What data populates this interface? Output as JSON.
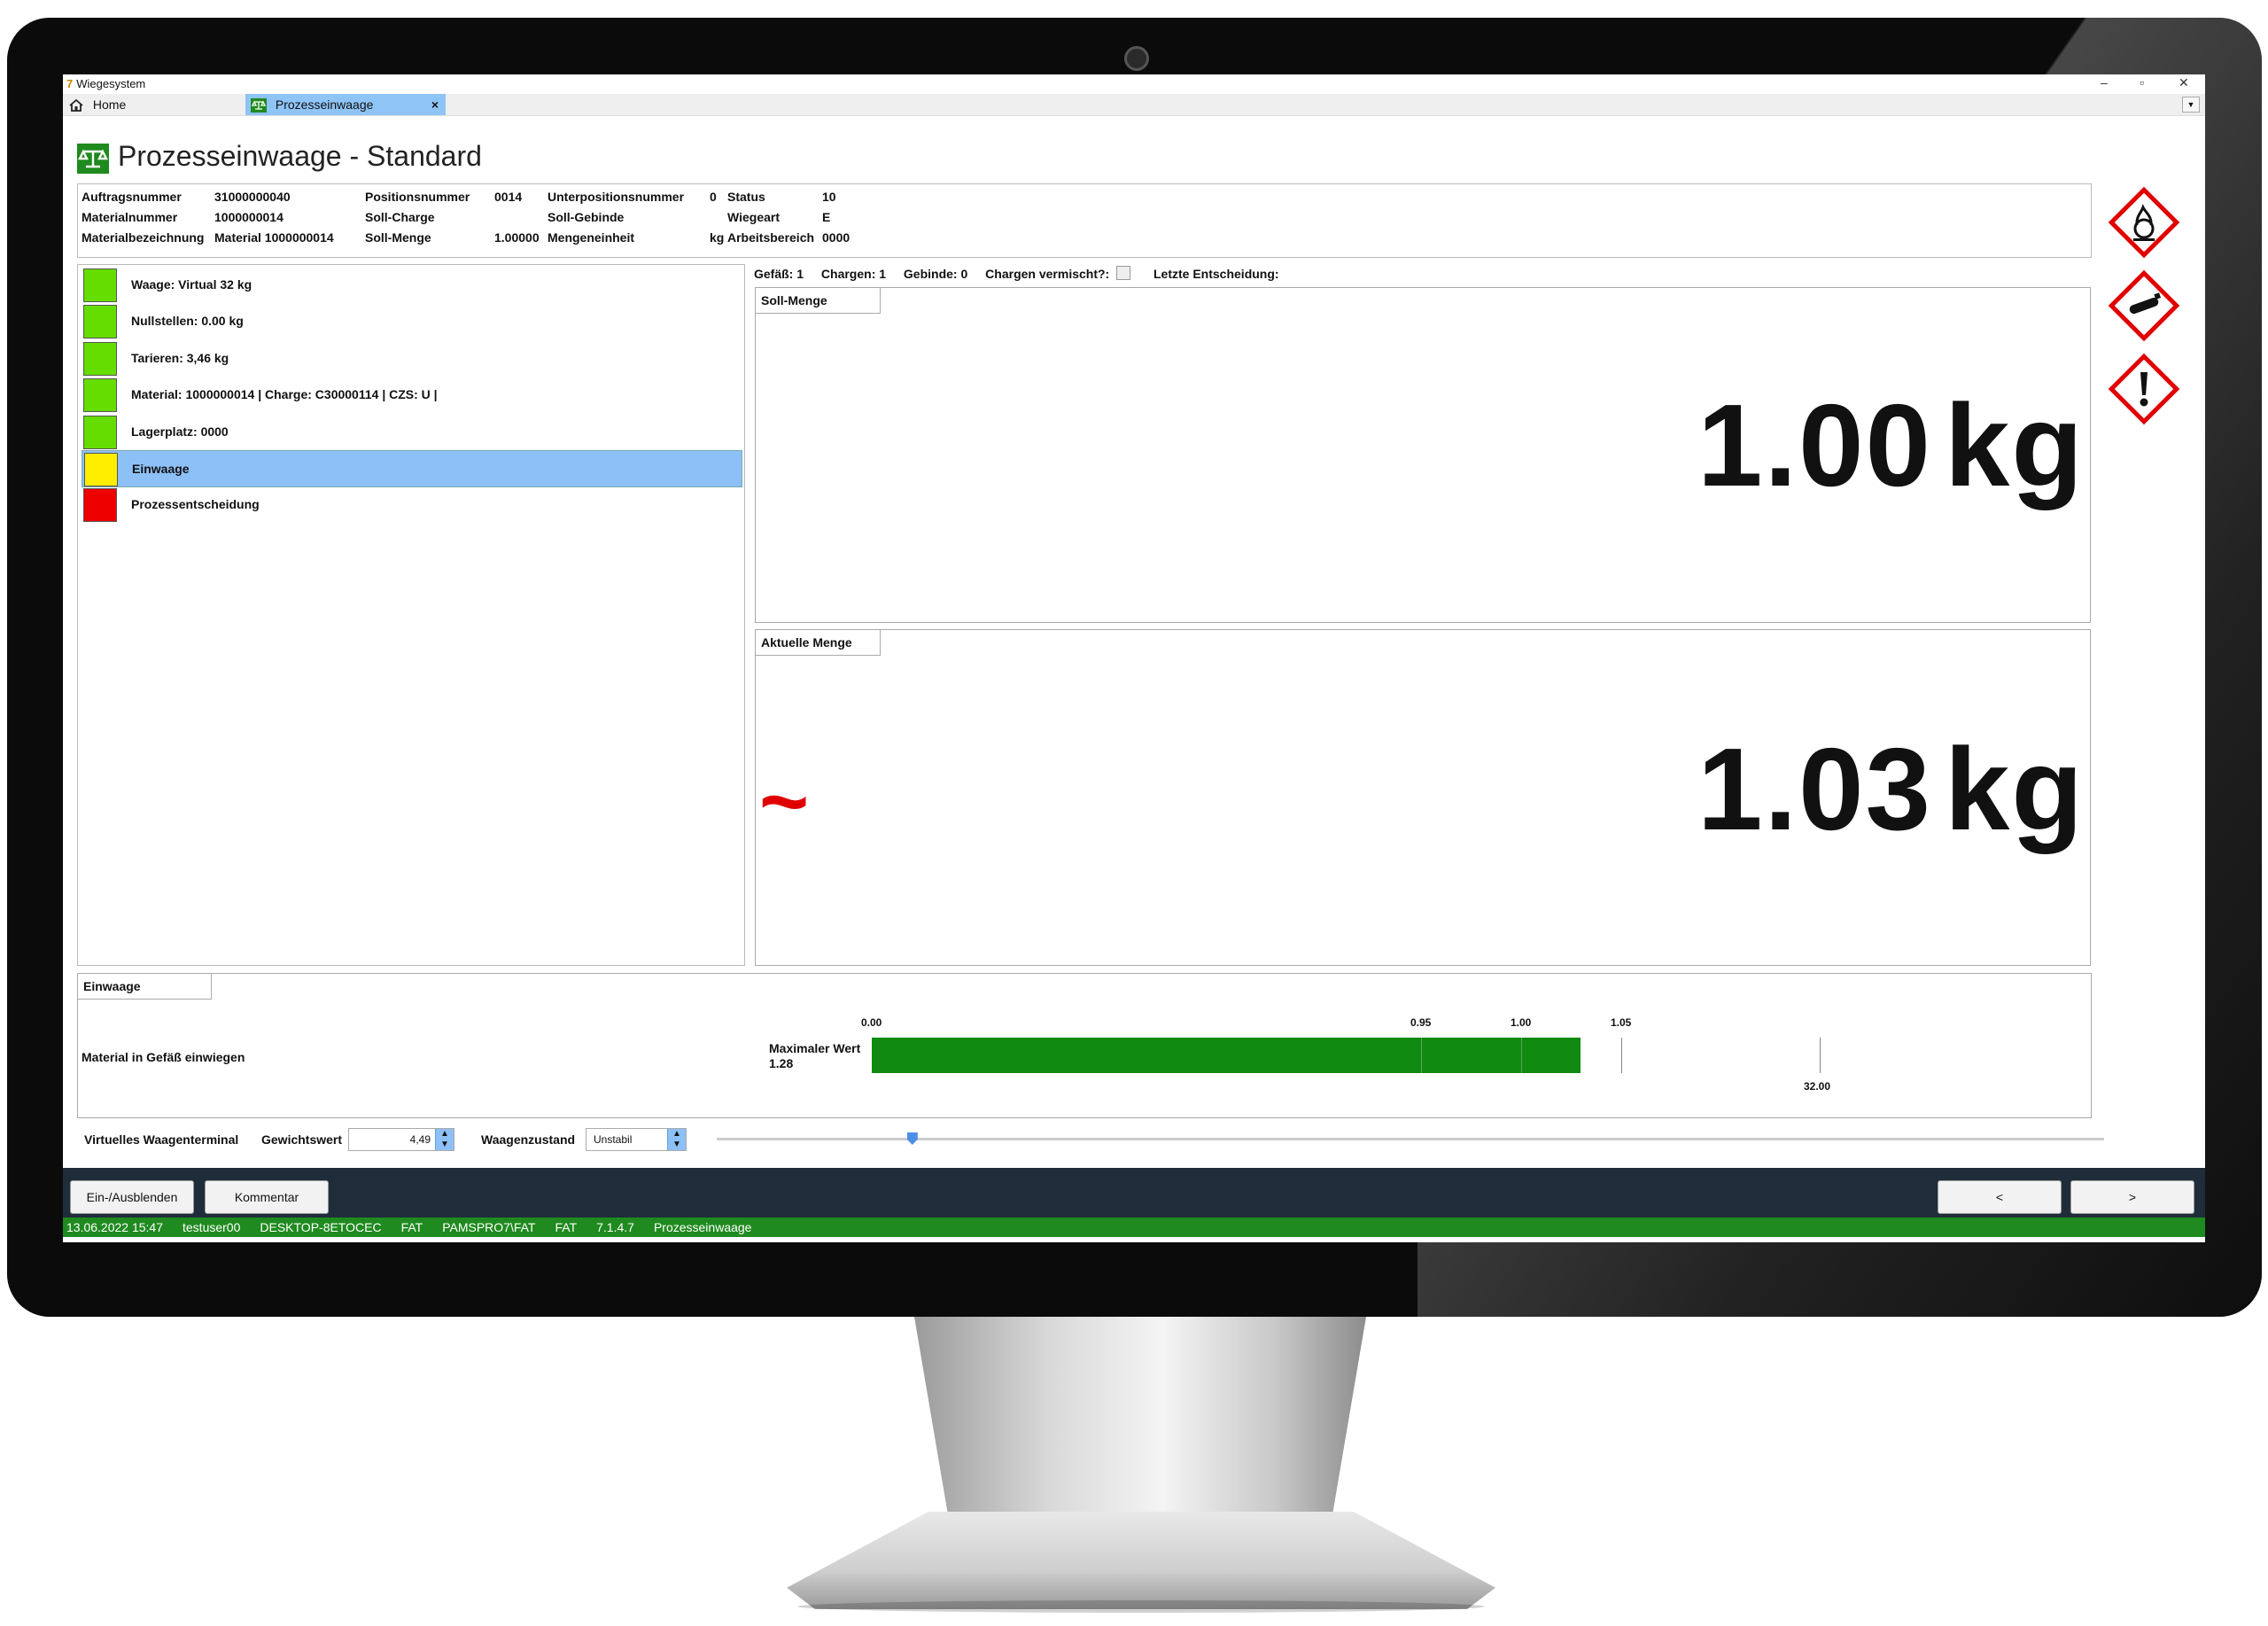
{
  "window": {
    "title": "Wiegesystem",
    "minimize": "–",
    "maximize": "▫",
    "close": "✕"
  },
  "tabs": {
    "home": "Home",
    "active": "Prozesseinwaage",
    "close": "×",
    "dropdown": "▼"
  },
  "page_title": "Prozesseinwaage - Standard",
  "info": {
    "auftragsnummer_label": "Auftragsnummer",
    "auftragsnummer": "31000000040",
    "materialnummer_label": "Materialnummer",
    "materialnummer": "1000000014",
    "materialbezeichnung_label": "Materialbezeichnung",
    "materialbezeichnung": "Material 1000000014",
    "positionsnummer_label": "Positionsnummer",
    "positionsnummer": "0014",
    "soll_charge_label": "Soll-Charge",
    "soll_charge": "",
    "soll_menge_label": "Soll-Menge",
    "soll_menge": "1.00000",
    "unterpositionsnummer_label": "Unterpositionsnummer",
    "unterpositionsnummer": "0",
    "soll_gebinde_label": "Soll-Gebinde",
    "soll_gebinde": "",
    "mengeneinheit_label": "Mengeneinheit",
    "mengeneinheit": "kg",
    "status_label": "Status",
    "status": "10",
    "wiegeart_label": "Wiegeart",
    "wiegeart": "E",
    "arbeitsbereich_label": "Arbeitsbereich",
    "arbeitsbereich": "0000"
  },
  "steps": [
    {
      "label": "Waage: Virtual 32 kg",
      "color": "#66dd00"
    },
    {
      "label": "Nullstellen: 0.00 kg",
      "color": "#66dd00"
    },
    {
      "label": "Tarieren: 3,46 kg",
      "color": "#66dd00"
    },
    {
      "label": "Material: 1000000014 | Charge: C30000114 | CZS: U |",
      "color": "#66dd00"
    },
    {
      "label": "Lagerplatz: 0000",
      "color": "#66dd00"
    },
    {
      "label": "Einwaage",
      "color": "#ffee00"
    },
    {
      "label": "Prozessentscheidung",
      "color": "#ee0000"
    }
  ],
  "vessel_row": {
    "gefaess": "Gefäß: 1",
    "chargen": "Chargen: 1",
    "gebinde": "Gebinde: 0",
    "vermischt": "Chargen vermischt?:",
    "letzte": "Letzte Entscheidung:"
  },
  "soll": {
    "caption": "Soll-Menge",
    "value": "1.00",
    "unit": "kg"
  },
  "aktuell": {
    "caption": "Aktuelle Menge",
    "value": "1.03",
    "unit": "kg",
    "unstable_symbol": "~"
  },
  "einwaage": {
    "caption": "Einwaage",
    "instruction": "Material in Gefäß einwiegen",
    "max_label": "Maximaler Wert",
    "max_value": "1.28",
    "ticks": [
      "0.00",
      "0.95",
      "1.00",
      "1.05"
    ],
    "scale_end": "32.00",
    "fill_fraction": 1.0,
    "bar_color": "#108a10"
  },
  "terminal": {
    "label": "Virtuelles Waagenterminal",
    "weight_label": "Gewichtswert",
    "weight_value": "4,49",
    "state_label": "Waagenzustand",
    "state_value": "Unstabil",
    "slider_fraction": 0.141
  },
  "footer": {
    "toggle": "Ein-/Ausblenden",
    "comment": "Kommentar",
    "prev": "<",
    "next": ">"
  },
  "status": [
    "13.06.2022 15:47",
    "testuser00",
    "DESKTOP-8ETOCEC",
    "FAT",
    "PAMSPRO7\\FAT",
    "FAT",
    "7.1.4.7",
    "Prozesseinwaage"
  ],
  "colors": {
    "accent": "#1f8a1f",
    "selection": "#8dc0f7",
    "footer": "#1f2d3a",
    "hazard": "#e00000"
  },
  "hazard_icons": [
    "oxidizing-flame-icon",
    "gas-cylinder-icon",
    "exclamation-icon"
  ]
}
